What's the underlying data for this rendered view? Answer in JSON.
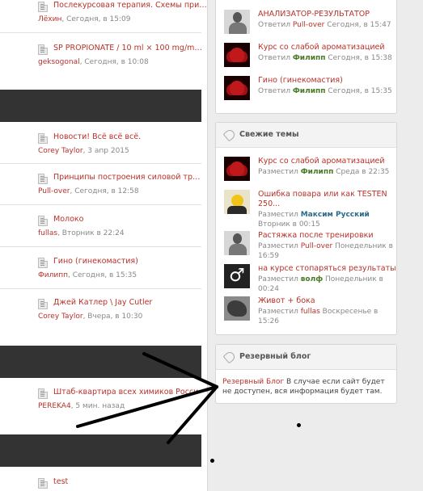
{
  "left_topics": [
    {
      "title": "Послекурсовая терапия. Схемы при…",
      "author": "Лёхин",
      "time": ", Сегодня, в 15:09"
    },
    {
      "title": "SP PROPIONATE / 10 ml × 100 mg/m…",
      "author": "geksogonal",
      "time": ", Сегодня, в 10:08"
    },
    {
      "title": "Новости! Всё всё всё.",
      "author": "Corey Taylor",
      "time": ", 3 апр 2015"
    },
    {
      "title": "Принципы построения силовой тр…",
      "author": "Pull-over",
      "time": ", Сегодня, в 12:58"
    },
    {
      "title": "Молоко",
      "author": "fullas",
      "time": ", Вторник в 22:24"
    },
    {
      "title": "Гино (гинекомастия)",
      "author": "Филипп",
      "time": ", Сегодня, в 15:35"
    },
    {
      "title": "Джей Катлер \\ Jay Cutler",
      "author": "Corey Taylor",
      "time": ", Вчера, в 10:30"
    },
    {
      "title": "Штаб-квартира всех химиков Росси",
      "author": "PEREKA4",
      "time": ", 5 мин. назад"
    },
    {
      "title": "test",
      "author": "",
      "time": ""
    }
  ],
  "replies_box": {
    "entries": [
      {
        "title": "АНАЛИЗАТОР-РЕЗУЛЬТАТОР",
        "prefix": "Ответил ",
        "author": "Pull-over",
        "time": " Сегодня, в 15:47"
      },
      {
        "title": "Курс со слабой ароматизацией",
        "prefix": "Ответил ",
        "author": "Филипп",
        "time": " Сегодня, в 15:38"
      },
      {
        "title": "Гино (гинекомастия)",
        "prefix": "Ответил ",
        "author": "Филипп",
        "time": " Сегодня, в 15:35"
      }
    ]
  },
  "fresh_topics": {
    "title": "Свежие темы",
    "entries": [
      {
        "title": "Курс со слабой ароматизацией",
        "prefix": "Разместил ",
        "author": "Филипп",
        "time": " Среда в 22:35"
      },
      {
        "title": "Ошибка повара или как TESTEN 250...",
        "prefix": "Разместил ",
        "author": "Максим Русский",
        "time": " Вторник в 00:15"
      },
      {
        "title": "Растяжка после тренировки",
        "prefix": "Разместил ",
        "author": "Pull-over",
        "time": " Понедельник в 16:59"
      },
      {
        "title": "на курсе стопаряться результаты",
        "prefix": "Разместил ",
        "author": "волф",
        "time": " Понедельник в 00:24"
      },
      {
        "title": "Живот + бока",
        "prefix": "Разместил ",
        "author": "fullas",
        "time": " Воскресенье в 15:26"
      }
    ]
  },
  "reserve_blog": {
    "title": "Резервный блог",
    "link": "Резервный Блог",
    "text": " В случае если сайт будет не доступен, вся информация будет там."
  },
  "icons": {
    "male_symbol": "♂"
  },
  "colors": {
    "link": "#b8312a",
    "author": "#4a7a25",
    "dark_band": "#333333"
  }
}
